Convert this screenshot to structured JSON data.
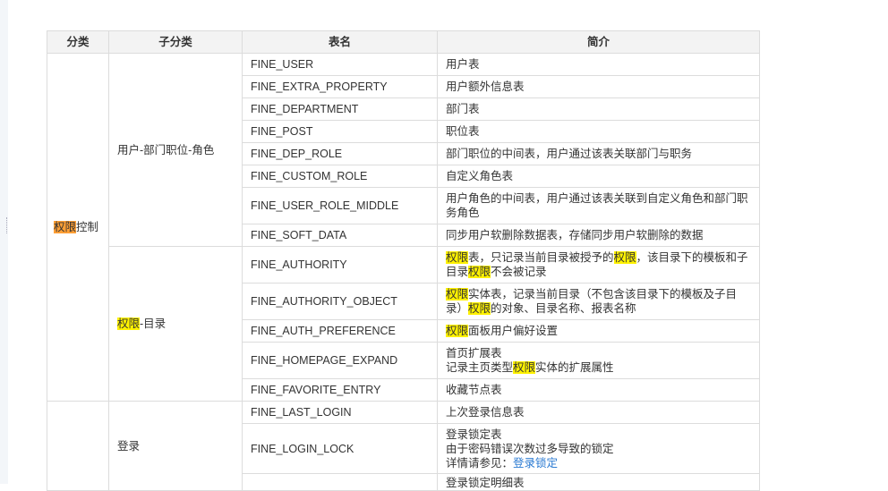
{
  "table": {
    "headers": [
      "分类",
      "子分类",
      "表名",
      "简介"
    ],
    "category1": {
      "hl": "权限",
      "rest": "控制"
    },
    "sub1": "用户-部门职位-角色",
    "sub2": {
      "hl": "权限",
      "rest": "-目录"
    },
    "category2": "",
    "sub3": "登录",
    "rows": [
      {
        "name": "FINE_USER",
        "desc": "用户表"
      },
      {
        "name": "FINE_EXTRA_PROPERTY",
        "desc": "用户额外信息表"
      },
      {
        "name": "FINE_DEPARTMENT",
        "desc": "部门表"
      },
      {
        "name": "FINE_POST",
        "desc": "职位表"
      },
      {
        "name": "FINE_DEP_ROLE",
        "desc": "部门职位的中间表，用户通过该表关联部门与职务"
      },
      {
        "name": "FINE_CUSTOM_ROLE",
        "desc": "自定义角色表"
      },
      {
        "name": "FINE_USER_ROLE_MIDDLE",
        "desc": "用户角色的中间表，用户通过该表关联到自定义角色和部门职务角色"
      },
      {
        "name": "FINE_SOFT_DATA",
        "desc": "同步用户软删除数据表，存储同步用户软删除的数据"
      },
      {
        "name": "FINE_AUTHORITY",
        "desc_parts": [
          "权限",
          "表，只记录当前目录被授予的",
          "权限",
          "，该目录下的模板和子目录",
          "权限",
          "不会被记录"
        ]
      },
      {
        "name": "FINE_AUTHORITY_OBJECT",
        "desc_parts": [
          "权限",
          "实体表，记录当前目录（不包含该目录下的模板及子目录）",
          "权限",
          "的对象、目录名称、报表名称"
        ]
      },
      {
        "name": "FINE_AUTH_PREFERENCE",
        "desc_parts": [
          "权限",
          "面板用户偏好设置"
        ]
      },
      {
        "name": "FINE_HOMEPAGE_EXPAND",
        "desc_line1": "首页扩展表",
        "desc_parts": [
          "记录主页类型",
          "权限",
          "实体的扩展属性"
        ]
      },
      {
        "name": "FINE_FAVORITE_ENTRY",
        "desc": "收藏节点表"
      },
      {
        "name": "FINE_LAST_LOGIN",
        "desc": "上次登录信息表"
      },
      {
        "name": "FINE_LOGIN_LOCK",
        "desc_line1": "登录锁定表",
        "desc_line2": "由于密码错误次数过多导致的锁定",
        "desc_line3_prefix": "详情请参见：",
        "desc_link": "登录锁定"
      },
      {
        "name": "",
        "desc": "登录锁定明细表"
      }
    ]
  },
  "colors": {
    "header_bg": "#f3f3f3",
    "border": "#dcdcdc",
    "highlight_yellow": "#fff200",
    "highlight_orange": "#ff9f35",
    "link": "#2a7ad2"
  }
}
